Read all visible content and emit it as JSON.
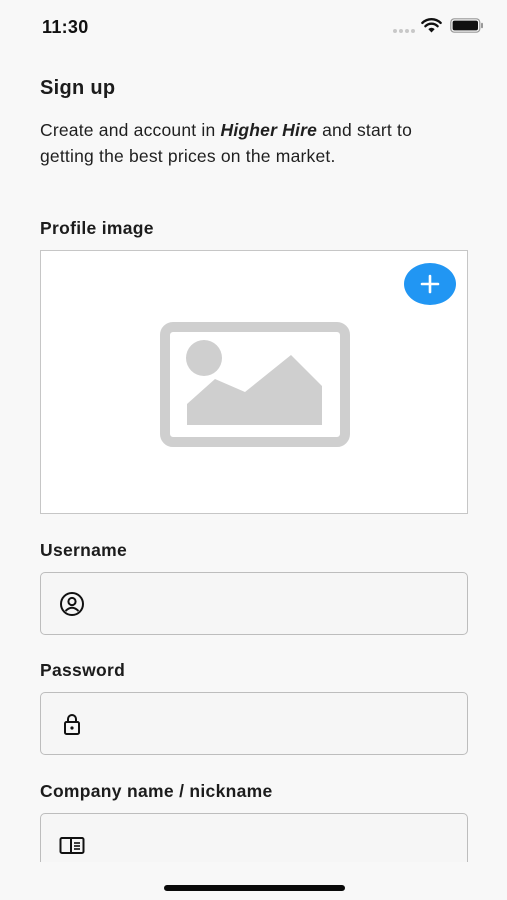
{
  "status_bar": {
    "time": "11:30",
    "icons": [
      "signal-dots-icon",
      "wifi-icon",
      "battery-icon"
    ]
  },
  "page": {
    "title": "Sign up",
    "intro_prefix": "Create and account in ",
    "intro_brand": "Higher Hire",
    "intro_suffix": " and start to getting the best prices on the market."
  },
  "profile_image": {
    "label": "Profile image",
    "placeholder_icon": "image-placeholder-icon",
    "add_icon": "plus-icon",
    "accent_color": "#2196f3"
  },
  "fields": {
    "username": {
      "label": "Username",
      "value": "",
      "placeholder": "",
      "icon": "user-circle-icon"
    },
    "password": {
      "label": "Password",
      "value": "",
      "placeholder": "",
      "icon": "lock-icon"
    },
    "company": {
      "label": "Company name / nickname",
      "value": "",
      "placeholder": "",
      "icon": "id-card-icon"
    }
  }
}
